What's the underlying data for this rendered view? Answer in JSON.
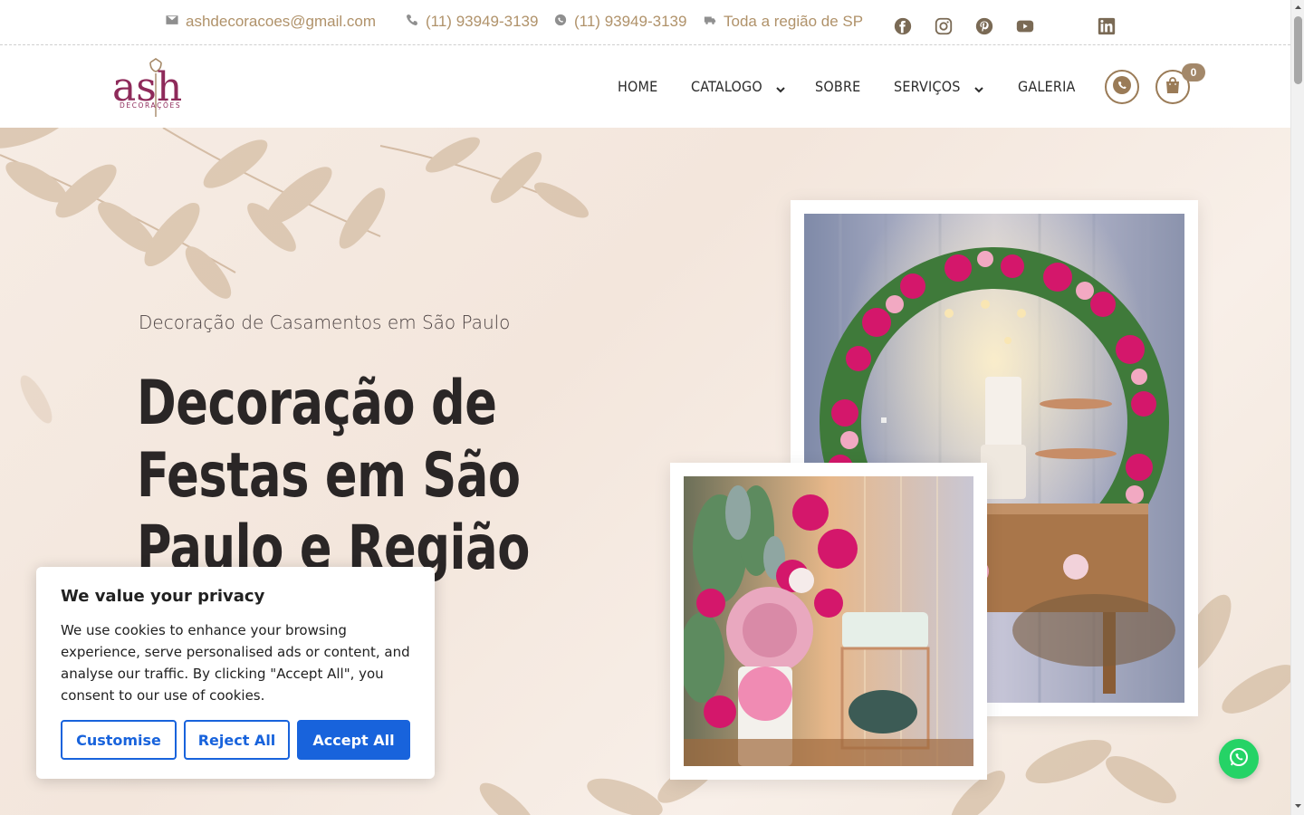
{
  "topbar": {
    "email": "ashdecoracoes@gmail.com",
    "phone": "(11) 93949-3139",
    "whatsapp": "(11) 93949-3139",
    "region": "Toda a região de SP",
    "icons": [
      "envelope-icon",
      "phone-icon",
      "whatsapp-icon",
      "truck-icon"
    ],
    "social": [
      "facebook-icon",
      "instagram-icon",
      "pinterest-icon",
      "youtube-icon",
      "linkedin-icon"
    ]
  },
  "logo": {
    "brand": "ash",
    "tagline": "DECORAÇÕES"
  },
  "nav": {
    "items": [
      {
        "label": "HOME",
        "dropdown": false
      },
      {
        "label": "CATALOGO",
        "dropdown": true
      },
      {
        "label": "SOBRE",
        "dropdown": false
      },
      {
        "label": "SERVIÇOS",
        "dropdown": true
      },
      {
        "label": "GALERIA",
        "dropdown": false
      }
    ],
    "cart_count": "0"
  },
  "hero": {
    "subtitle": "Decoração de Casamentos em São Paulo",
    "title": "Decoração de Festas em São Paulo e Região"
  },
  "cookie": {
    "title": "We value your privacy",
    "body": "We use cookies to enhance your browsing experience, serve personalised ads or content, and analyse our traffic. By clicking \"Accept All\", you consent to our use of cookies.",
    "customise": "Customise",
    "reject": "Reject All",
    "accept": "Accept All"
  },
  "colors": {
    "accent": "#b0926a",
    "brand": "#8e2a5a",
    "cookie_button": "#1863dc",
    "whatsapp": "#25d366"
  }
}
